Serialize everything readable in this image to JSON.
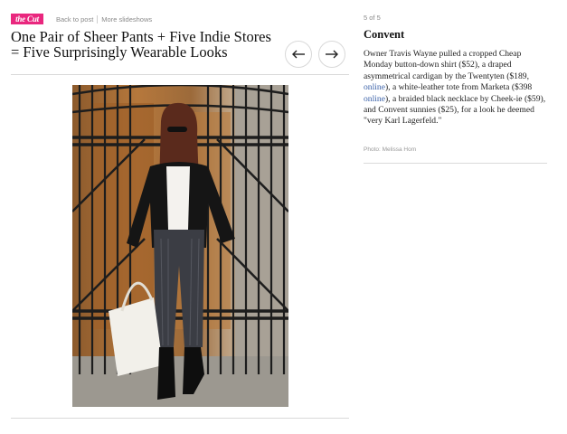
{
  "nav": {
    "logo_text": "the Cut",
    "back_label": "Back to post",
    "more_label": "More slideshows"
  },
  "slideshow": {
    "title": "One Pair of Sheer Pants + Five Indie Stores = Five Surprisingly Wearable Looks",
    "prev_icon": "arrow-left-icon",
    "next_icon": "arrow-right-icon"
  },
  "photo": {
    "alt_subject": "woman in sheer pants standing in front of wrought-iron gate"
  },
  "caption": {
    "counter": "5 of 5",
    "title": "Convent",
    "text_1": "Owner Travis Wayne pulled a cropped Cheap Monday button-down shirt ($52), a draped asymmetrical cardigan by the Twentyten ($189, ",
    "link_1": "online",
    "text_2": "), a white-leather tote from Marketa ($398 ",
    "link_2": "online",
    "text_3": "), a braided black necklace by Cheek-ie ($59), and Convent sunnies ($25), for a look he deemed \"very Karl Lagerfeld.\"",
    "credit": "Photo: Melissa Hom"
  },
  "colors": {
    "brand_pink": "#e9277e",
    "link_blue": "#3b62a8"
  }
}
